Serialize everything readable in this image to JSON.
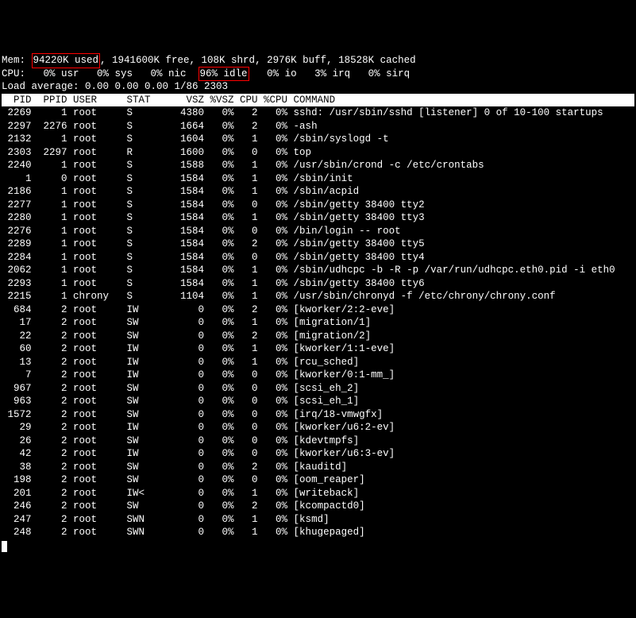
{
  "mem": {
    "used": "94220K used",
    "free": "1941600K free",
    "shrd": "108K shrd",
    "buff": "2976K buff",
    "cached": "18528K cached"
  },
  "cpu": {
    "usr": "0% usr",
    "sys": "0% sys",
    "nic": "0% nic",
    "idle": "96% idle",
    "io": "0% io",
    "irq": "3% irq",
    "sirq": "0% sirq"
  },
  "load": "Load average: 0.00 0.00 0.00 1/86 2303",
  "headers": {
    "pid": "PID",
    "ppid": "PPID",
    "user": "USER",
    "stat": "STAT",
    "vsz": "VSZ",
    "pvsz": "%VSZ",
    "cpu": "CPU",
    "pcpu": "%CPU",
    "command": "COMMAND"
  },
  "rows": [
    {
      "pid": "2269",
      "ppid": "1",
      "user": "root",
      "stat": "S",
      "vsz": "4380",
      "pvsz": "0%",
      "cpu": "2",
      "pcpu": "0%",
      "cmd": "sshd: /usr/sbin/sshd [listener] 0 of 10-100 startups"
    },
    {
      "pid": "2297",
      "ppid": "2276",
      "user": "root",
      "stat": "S",
      "vsz": "1664",
      "pvsz": "0%",
      "cpu": "2",
      "pcpu": "0%",
      "cmd": "-ash"
    },
    {
      "pid": "2132",
      "ppid": "1",
      "user": "root",
      "stat": "S",
      "vsz": "1604",
      "pvsz": "0%",
      "cpu": "1",
      "pcpu": "0%",
      "cmd": "/sbin/syslogd -t"
    },
    {
      "pid": "2303",
      "ppid": "2297",
      "user": "root",
      "stat": "R",
      "vsz": "1600",
      "pvsz": "0%",
      "cpu": "0",
      "pcpu": "0%",
      "cmd": "top"
    },
    {
      "pid": "2240",
      "ppid": "1",
      "user": "root",
      "stat": "S",
      "vsz": "1588",
      "pvsz": "0%",
      "cpu": "1",
      "pcpu": "0%",
      "cmd": "/usr/sbin/crond -c /etc/crontabs"
    },
    {
      "pid": "1",
      "ppid": "0",
      "user": "root",
      "stat": "S",
      "vsz": "1584",
      "pvsz": "0%",
      "cpu": "1",
      "pcpu": "0%",
      "cmd": "/sbin/init"
    },
    {
      "pid": "2186",
      "ppid": "1",
      "user": "root",
      "stat": "S",
      "vsz": "1584",
      "pvsz": "0%",
      "cpu": "1",
      "pcpu": "0%",
      "cmd": "/sbin/acpid"
    },
    {
      "pid": "2277",
      "ppid": "1",
      "user": "root",
      "stat": "S",
      "vsz": "1584",
      "pvsz": "0%",
      "cpu": "0",
      "pcpu": "0%",
      "cmd": "/sbin/getty 38400 tty2"
    },
    {
      "pid": "2280",
      "ppid": "1",
      "user": "root",
      "stat": "S",
      "vsz": "1584",
      "pvsz": "0%",
      "cpu": "1",
      "pcpu": "0%",
      "cmd": "/sbin/getty 38400 tty3"
    },
    {
      "pid": "2276",
      "ppid": "1",
      "user": "root",
      "stat": "S",
      "vsz": "1584",
      "pvsz": "0%",
      "cpu": "0",
      "pcpu": "0%",
      "cmd": "/bin/login -- root"
    },
    {
      "pid": "2289",
      "ppid": "1",
      "user": "root",
      "stat": "S",
      "vsz": "1584",
      "pvsz": "0%",
      "cpu": "2",
      "pcpu": "0%",
      "cmd": "/sbin/getty 38400 tty5"
    },
    {
      "pid": "2284",
      "ppid": "1",
      "user": "root",
      "stat": "S",
      "vsz": "1584",
      "pvsz": "0%",
      "cpu": "0",
      "pcpu": "0%",
      "cmd": "/sbin/getty 38400 tty4"
    },
    {
      "pid": "2062",
      "ppid": "1",
      "user": "root",
      "stat": "S",
      "vsz": "1584",
      "pvsz": "0%",
      "cpu": "1",
      "pcpu": "0%",
      "cmd": "/sbin/udhcpc -b -R -p /var/run/udhcpc.eth0.pid -i eth0"
    },
    {
      "pid": "2293",
      "ppid": "1",
      "user": "root",
      "stat": "S",
      "vsz": "1584",
      "pvsz": "0%",
      "cpu": "1",
      "pcpu": "0%",
      "cmd": "/sbin/getty 38400 tty6"
    },
    {
      "pid": "2215",
      "ppid": "1",
      "user": "chrony",
      "stat": "S",
      "vsz": "1104",
      "pvsz": "0%",
      "cpu": "1",
      "pcpu": "0%",
      "cmd": "/usr/sbin/chronyd -f /etc/chrony/chrony.conf"
    },
    {
      "pid": "684",
      "ppid": "2",
      "user": "root",
      "stat": "IW",
      "vsz": "0",
      "pvsz": "0%",
      "cpu": "2",
      "pcpu": "0%",
      "cmd": "[kworker/2:2-eve]"
    },
    {
      "pid": "17",
      "ppid": "2",
      "user": "root",
      "stat": "SW",
      "vsz": "0",
      "pvsz": "0%",
      "cpu": "1",
      "pcpu": "0%",
      "cmd": "[migration/1]"
    },
    {
      "pid": "22",
      "ppid": "2",
      "user": "root",
      "stat": "SW",
      "vsz": "0",
      "pvsz": "0%",
      "cpu": "2",
      "pcpu": "0%",
      "cmd": "[migration/2]"
    },
    {
      "pid": "60",
      "ppid": "2",
      "user": "root",
      "stat": "IW",
      "vsz": "0",
      "pvsz": "0%",
      "cpu": "1",
      "pcpu": "0%",
      "cmd": "[kworker/1:1-eve]"
    },
    {
      "pid": "13",
      "ppid": "2",
      "user": "root",
      "stat": "IW",
      "vsz": "0",
      "pvsz": "0%",
      "cpu": "1",
      "pcpu": "0%",
      "cmd": "[rcu_sched]"
    },
    {
      "pid": "7",
      "ppid": "2",
      "user": "root",
      "stat": "IW",
      "vsz": "0",
      "pvsz": "0%",
      "cpu": "0",
      "pcpu": "0%",
      "cmd": "[kworker/0:1-mm_]"
    },
    {
      "pid": "967",
      "ppid": "2",
      "user": "root",
      "stat": "SW",
      "vsz": "0",
      "pvsz": "0%",
      "cpu": "0",
      "pcpu": "0%",
      "cmd": "[scsi_eh_2]"
    },
    {
      "pid": "963",
      "ppid": "2",
      "user": "root",
      "stat": "SW",
      "vsz": "0",
      "pvsz": "0%",
      "cpu": "0",
      "pcpu": "0%",
      "cmd": "[scsi_eh_1]"
    },
    {
      "pid": "1572",
      "ppid": "2",
      "user": "root",
      "stat": "SW",
      "vsz": "0",
      "pvsz": "0%",
      "cpu": "0",
      "pcpu": "0%",
      "cmd": "[irq/18-vmwgfx]"
    },
    {
      "pid": "29",
      "ppid": "2",
      "user": "root",
      "stat": "IW",
      "vsz": "0",
      "pvsz": "0%",
      "cpu": "0",
      "pcpu": "0%",
      "cmd": "[kworker/u6:2-ev]"
    },
    {
      "pid": "26",
      "ppid": "2",
      "user": "root",
      "stat": "SW",
      "vsz": "0",
      "pvsz": "0%",
      "cpu": "0",
      "pcpu": "0%",
      "cmd": "[kdevtmpfs]"
    },
    {
      "pid": "42",
      "ppid": "2",
      "user": "root",
      "stat": "IW",
      "vsz": "0",
      "pvsz": "0%",
      "cpu": "0",
      "pcpu": "0%",
      "cmd": "[kworker/u6:3-ev]"
    },
    {
      "pid": "38",
      "ppid": "2",
      "user": "root",
      "stat": "SW",
      "vsz": "0",
      "pvsz": "0%",
      "cpu": "2",
      "pcpu": "0%",
      "cmd": "[kauditd]"
    },
    {
      "pid": "198",
      "ppid": "2",
      "user": "root",
      "stat": "SW",
      "vsz": "0",
      "pvsz": "0%",
      "cpu": "0",
      "pcpu": "0%",
      "cmd": "[oom_reaper]"
    },
    {
      "pid": "201",
      "ppid": "2",
      "user": "root",
      "stat": "IW<",
      "vsz": "0",
      "pvsz": "0%",
      "cpu": "1",
      "pcpu": "0%",
      "cmd": "[writeback]"
    },
    {
      "pid": "246",
      "ppid": "2",
      "user": "root",
      "stat": "SW",
      "vsz": "0",
      "pvsz": "0%",
      "cpu": "2",
      "pcpu": "0%",
      "cmd": "[kcompactd0]"
    },
    {
      "pid": "247",
      "ppid": "2",
      "user": "root",
      "stat": "SWN",
      "vsz": "0",
      "pvsz": "0%",
      "cpu": "1",
      "pcpu": "0%",
      "cmd": "[ksmd]"
    },
    {
      "pid": "248",
      "ppid": "2",
      "user": "root",
      "stat": "SWN",
      "vsz": "0",
      "pvsz": "0%",
      "cpu": "1",
      "pcpu": "0%",
      "cmd": "[khugepaged]"
    }
  ]
}
